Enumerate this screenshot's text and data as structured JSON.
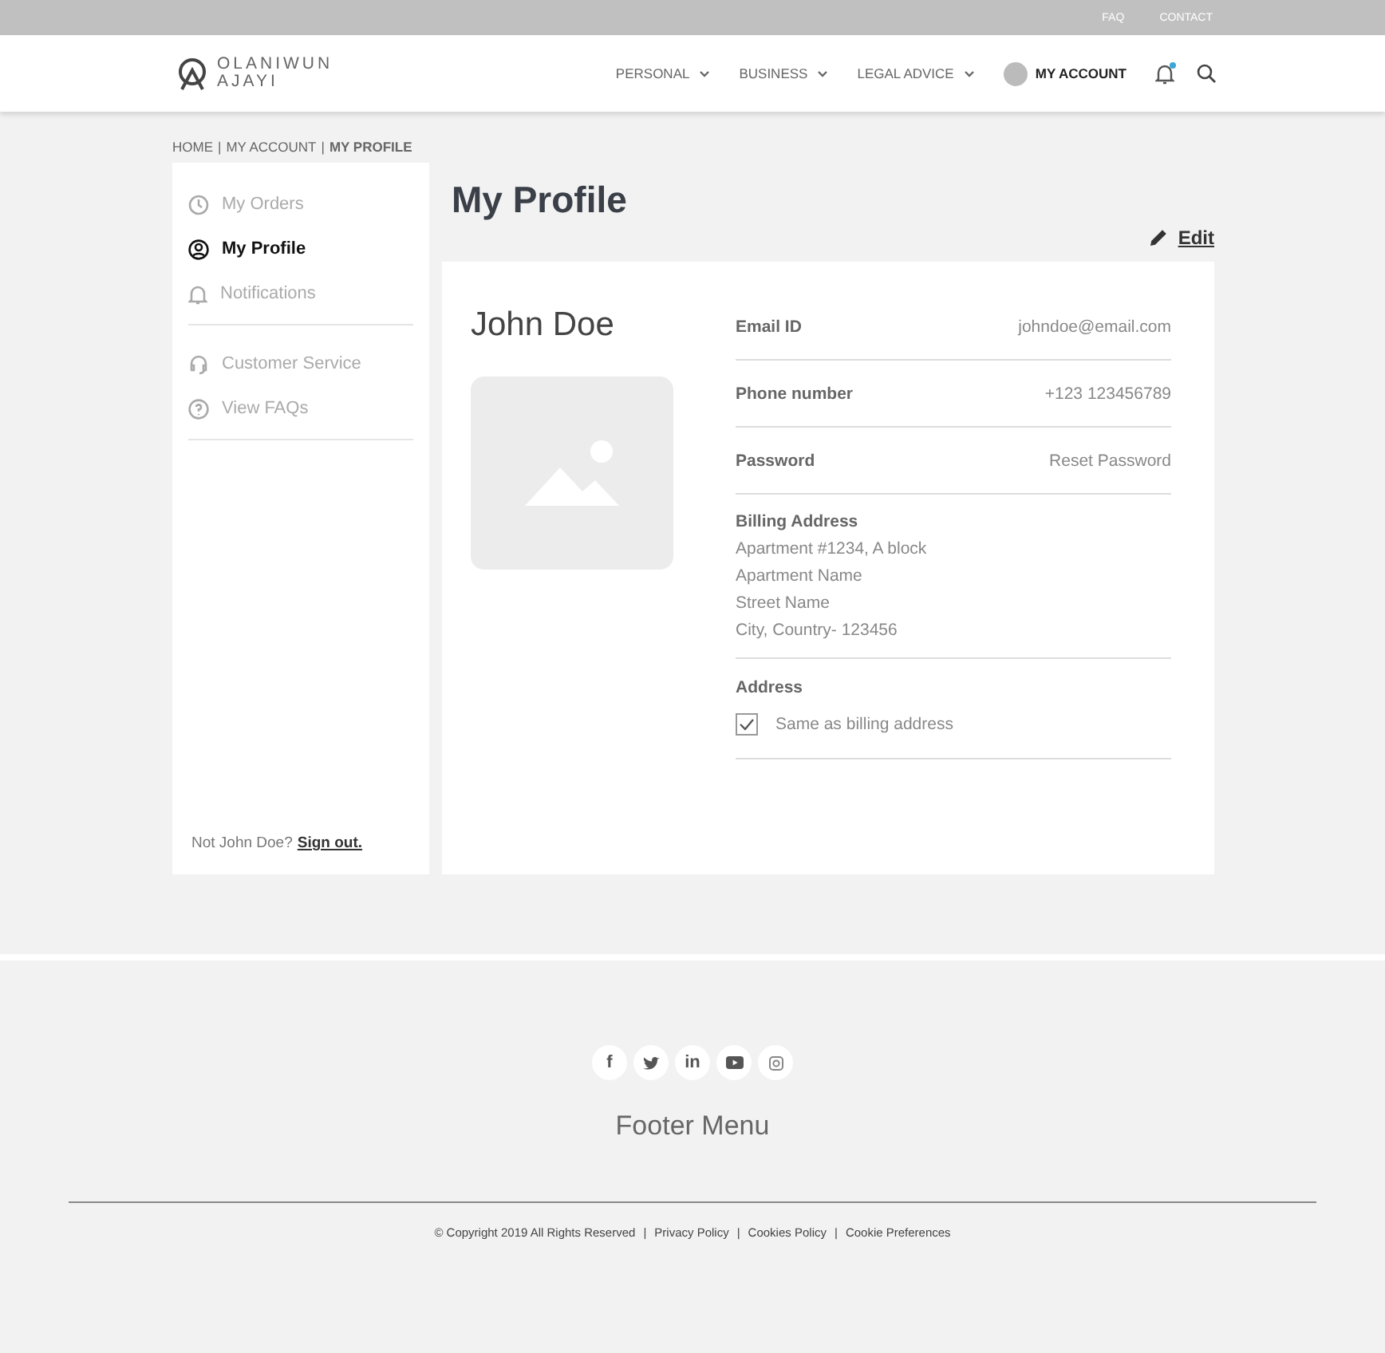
{
  "top_bar": {
    "links": [
      "FAQ",
      "CONTACT"
    ]
  },
  "header": {
    "logo": {
      "line_1": "OLANIWUN",
      "line_2": "AJAYI"
    },
    "nav": [
      {
        "label": "PERSONAL",
        "kind": "dropdown"
      },
      {
        "label": "BUSINESS",
        "kind": "dropdown"
      },
      {
        "label": "LEGAL ADVICE",
        "kind": "dropdown"
      },
      {
        "label": "MY ACCOUNT",
        "kind": "account"
      }
    ],
    "notification_unread": true
  },
  "breadcrumb": {
    "separator": "|",
    "items": [
      {
        "label": "HOME",
        "selected": false
      },
      {
        "label": "MY ACCOUNT",
        "selected": false
      },
      {
        "label": "MY PROFILE",
        "selected": true
      }
    ]
  },
  "sidebar": {
    "groups": [
      [
        {
          "label": "My Orders",
          "kind": "clock",
          "selected": false
        },
        {
          "label": "My Profile",
          "kind": "user",
          "selected": true
        },
        {
          "label": "Notifications",
          "kind": "bell",
          "selected": false
        }
      ],
      [
        {
          "label": "Customer Service",
          "kind": "headset",
          "selected": false
        },
        {
          "label": "View FAQs",
          "kind": "help",
          "selected": false
        }
      ]
    ],
    "signout_prompt": "Not John Doe?",
    "signout_link": "Sign out."
  },
  "page_title": "My Profile",
  "edit_link": "Edit",
  "profile": {
    "name": "John Doe",
    "photo": {
      "kind": "placeholder"
    },
    "fields": [
      {
        "kind": "pair",
        "label": "Email ID",
        "value": "johndoe@email.com"
      },
      {
        "kind": "pair",
        "label": "Phone number",
        "value": "+123 123456789"
      },
      {
        "kind": "pair",
        "label": "Password",
        "value": "Reset Password"
      },
      {
        "kind": "block",
        "label": "Billing Address",
        "lines": [
          "Apartment #1234, A block",
          "Apartment Name",
          "Street Name",
          "City, Country- 123456"
        ]
      },
      {
        "kind": "check",
        "label": "Address",
        "option": "Same as billing address",
        "checked": true
      }
    ]
  },
  "footer": {
    "social": [
      {
        "kind": "letter",
        "text": "f"
      },
      {
        "kind": "bird"
      },
      {
        "kind": "letter",
        "text": "in"
      },
      {
        "kind": "play"
      },
      {
        "kind": "camera"
      }
    ],
    "menu_title": "Footer Menu",
    "copyright": "© Copyright 2019 All Rights Reserved",
    "separator": "|",
    "links": [
      "Privacy Policy",
      "Cookies Policy",
      "Cookie Preferences"
    ]
  }
}
